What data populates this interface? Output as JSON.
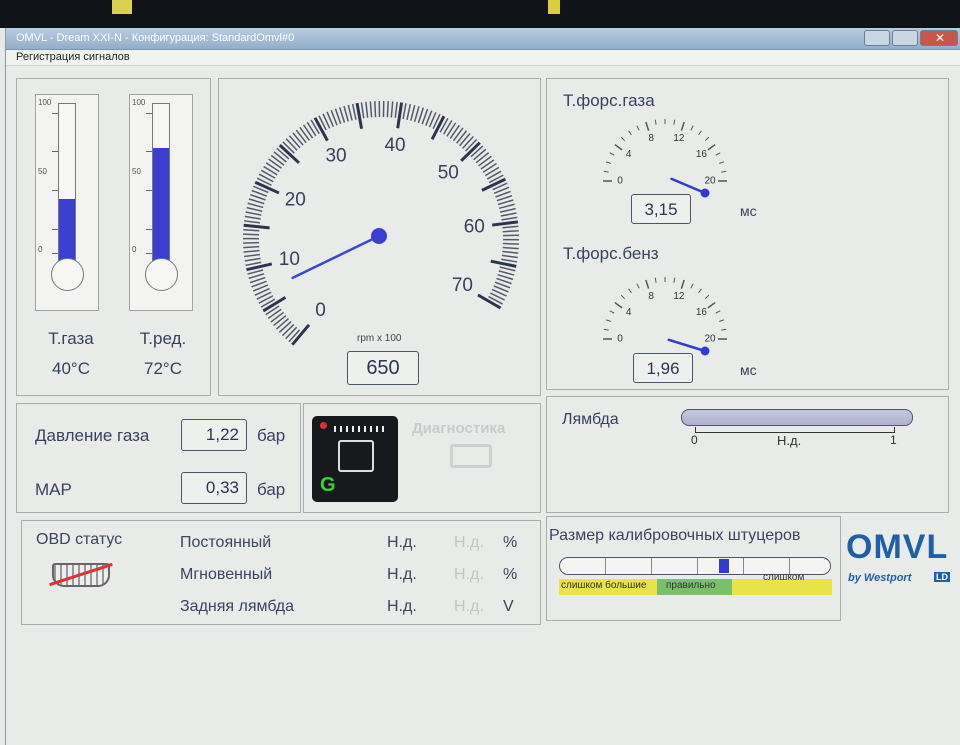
{
  "window": {
    "title": "OMVL - Dream XXI-N - Конфигурация: StandardOmvl#0",
    "menu": "Регистрация сигналов"
  },
  "thermometers": [
    {
      "label": "Т.газа",
      "value": "40°C",
      "fill_fraction": 0.4,
      "scale": [
        "100",
        "50",
        "0"
      ]
    },
    {
      "label": "Т.ред.",
      "value": "72°C",
      "fill_fraction": 0.72,
      "scale": [
        "100",
        "50",
        "0"
      ]
    }
  ],
  "tacho": {
    "unit": "rpm x 100",
    "value": "650",
    "ticks": [
      "0",
      "10",
      "20",
      "30",
      "40",
      "50",
      "60",
      "70"
    ],
    "max": 70,
    "rpm": 6.5
  },
  "injection_gas": {
    "title": "Т.форс.газа",
    "value": "3,15",
    "unit": "мс",
    "ticks": [
      "0",
      "4",
      "8",
      "12",
      "16",
      "20"
    ],
    "max": 20,
    "reading": 3.15
  },
  "injection_petrol": {
    "title": "Т.форс.бенз",
    "value": "1,96",
    "unit": "мс",
    "ticks": [
      "0",
      "4",
      "8",
      "12",
      "16",
      "20"
    ],
    "max": 20,
    "reading": 1.96
  },
  "pressure": {
    "gas_label": "Давление газа",
    "gas_value": "1,22",
    "gas_unit": "бар",
    "map_label": "МАР",
    "map_value": "0,33",
    "map_unit": "бар"
  },
  "diagnostics": {
    "label": "Диагностика",
    "ecu_letter": "G"
  },
  "lambda": {
    "label": "Лямбда",
    "min": "0",
    "max": "1",
    "status": "Н.д."
  },
  "obd": {
    "title": "OBD статус",
    "rows": [
      {
        "label": "Постоянный",
        "value": "Н.д.",
        "secondary": "Н.д.",
        "unit": "%"
      },
      {
        "label": "Мгновенный",
        "value": "Н.д.",
        "secondary": "Н.д.",
        "unit": "%"
      },
      {
        "label": "Задняя лямбда",
        "value": "Н.д.",
        "secondary": "Н.д.",
        "unit": "V"
      }
    ]
  },
  "calibration": {
    "title": "Размер калибровочных штуцеров",
    "too_big": "слишком большие",
    "correct": "правильно",
    "too_small": "слишком",
    "marker_fraction": 0.59
  },
  "logo": {
    "brand": "OMVL",
    "sub": "by Westport",
    "badge": "LD"
  },
  "colors": {
    "accent": "#2f3ccf",
    "needle": "#3a46d8",
    "correct_green": "#78c06a",
    "warn_yellow": "#e9e24a"
  }
}
